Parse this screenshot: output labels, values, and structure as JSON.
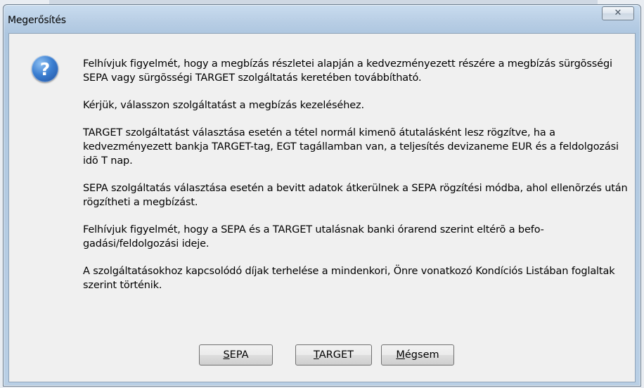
{
  "dialog": {
    "title": "Megerősítés",
    "close_icon": "close-icon",
    "question_icon": "question-icon",
    "paragraphs": [
      "Felhívjuk figyelmét, hogy a megbízás részletei alapján a kedvezményezett részére a megbízás sürgõsségi SEPA vagy sürgõsségi TARGET szolgáltatás keretében továbbítható.",
      "Kérjük, válasszon szolgáltatást a megbízás kezeléséhez.",
      "TARGET szolgáltatást választása esetén a tétel normál kimenõ átutalásként lesz rögzítve, ha a kedvezményezett bankja TARGET-tag, EGT tagállamban van, a teljesítés devizaneme EUR és a feldolgozási idõ T nap.",
      "SEPA szolgáltatás választása esetén a bevitt adatok átkerülnek a SEPA rögzítési módba, ahol ellenõrzés után rögzítheti a megbízást.",
      "Felhívjuk figyelmét, hogy a SEPA és a TARGET utalásnak banki órarend szerint eltérõ a befo-gadási/feldolgozási ideje.",
      "A szolgáltatásokhoz kapcsolódó díjak terhelése a mindenkori, Önre vonatkozó Kondíciós Listában foglaltak szerint történik."
    ],
    "buttons": {
      "sepa": {
        "accel": "S",
        "rest": "EPA"
      },
      "target": {
        "accel": "T",
        "rest": "ARGET"
      },
      "megsem": {
        "accel": "M",
        "rest": "égsem"
      }
    }
  },
  "colors": {
    "title_bar": "#b7cde4",
    "client_bg": "#f0f0f0",
    "icon_blue": "#3c7fd1"
  }
}
